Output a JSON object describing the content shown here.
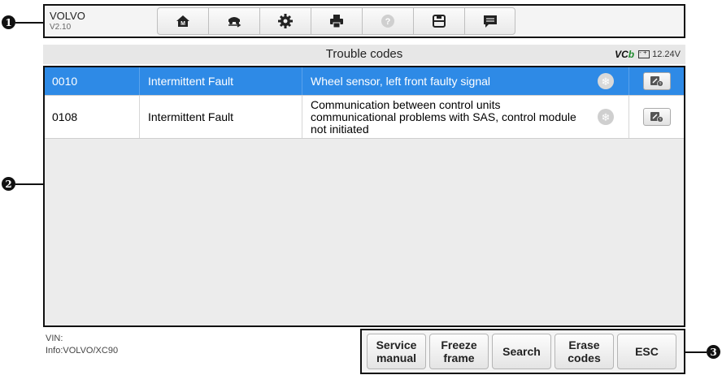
{
  "callouts": [
    "1",
    "2",
    "3"
  ],
  "toolbar": {
    "brand": "VOLVO",
    "version": "V2.10",
    "buttons": [
      {
        "name": "home-button",
        "icon": "home-icon"
      },
      {
        "name": "vehicle-swap-button",
        "icon": "vehicle-swap-icon"
      },
      {
        "name": "settings-button",
        "icon": "gear-icon"
      },
      {
        "name": "print-button",
        "icon": "printer-icon"
      },
      {
        "name": "help-button",
        "icon": "help-icon"
      },
      {
        "name": "save-button",
        "icon": "save-icon"
      },
      {
        "name": "data-logging-button",
        "icon": "chat-icon"
      }
    ]
  },
  "titlebar": {
    "title": "Trouble codes",
    "vci_text": "VC",
    "vci_accent": "b",
    "voltage": "12.24V"
  },
  "codes": [
    {
      "code": "0010",
      "status": "Intermittent Fault",
      "description": "Wheel sensor, left front faulty signal",
      "selected": true
    },
    {
      "code": "0108",
      "status": "Intermittent Fault",
      "description": "Communication between control units communicational problems with SAS, control module not initiated",
      "selected": false
    }
  ],
  "footer": {
    "vin_label": "VIN:",
    "info_label": "Info:VOLVO/XC90",
    "buttons": [
      {
        "label": "Service\nmanual"
      },
      {
        "label": "Freeze\nframe"
      },
      {
        "label": "Search"
      },
      {
        "label": "Erase\ncodes"
      },
      {
        "label": "ESC"
      }
    ]
  },
  "colors": {
    "selected_row": "#2e8ae6",
    "list_bg": "#ececec",
    "frame": "#111111"
  }
}
